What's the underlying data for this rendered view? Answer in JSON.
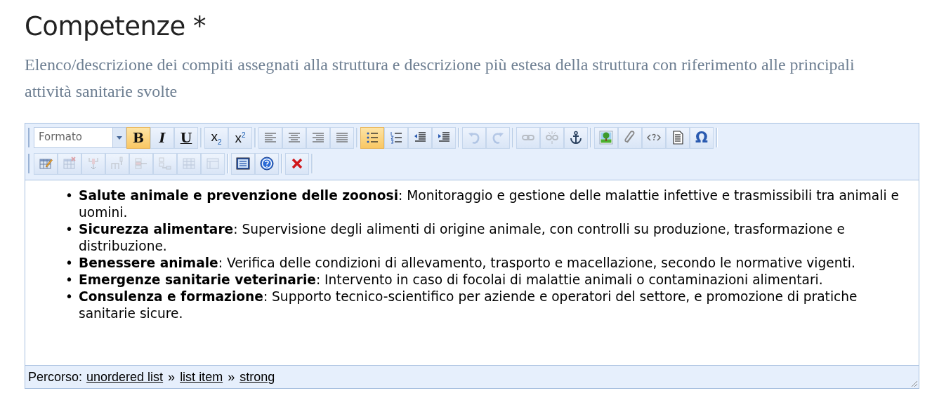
{
  "heading": {
    "title": "Competenze *",
    "description": "Elenco/descrizione dei compiti assegnati alla struttura e descrizione più estesa della struttura con riferimento alle principali attività sanitarie svolte"
  },
  "editor": {
    "toolbar_rows": [
      [
        {
          "kind": "format",
          "placeholder": "Formato"
        },
        {
          "kind": "bold",
          "glyph": "B",
          "active": true,
          "disabled": false
        },
        {
          "kind": "italic",
          "glyph": "I",
          "active": false,
          "disabled": false
        },
        {
          "kind": "underline",
          "glyph": "U",
          "active": false,
          "disabled": false
        },
        {
          "kind": "sep"
        },
        {
          "kind": "subscript",
          "glyph": "x$_{2}$",
          "active": false,
          "disabled": false
        },
        {
          "kind": "superscript",
          "glyph": "x$^{2}$",
          "active": false,
          "disabled": false
        },
        {
          "kind": "sep"
        },
        {
          "kind": "align-left",
          "active": false,
          "disabled": false
        },
        {
          "kind": "align-center",
          "active": false,
          "disabled": false
        },
        {
          "kind": "align-right",
          "active": false,
          "disabled": false
        },
        {
          "kind": "justify",
          "active": false,
          "disabled": false
        },
        {
          "kind": "sep"
        },
        {
          "kind": "bullet-list",
          "active": true,
          "disabled": false
        },
        {
          "kind": "numbered-list",
          "active": false,
          "disabled": false
        },
        {
          "kind": "outdent",
          "active": false,
          "disabled": false
        },
        {
          "kind": "indent",
          "active": false,
          "disabled": false
        },
        {
          "kind": "sep"
        },
        {
          "kind": "undo",
          "active": false,
          "disabled": true
        },
        {
          "kind": "redo",
          "active": false,
          "disabled": true
        },
        {
          "kind": "sep"
        },
        {
          "kind": "link",
          "active": false,
          "disabled": true
        },
        {
          "kind": "unlink",
          "active": false,
          "disabled": true
        },
        {
          "kind": "anchor",
          "active": false,
          "disabled": false
        },
        {
          "kind": "sep"
        },
        {
          "kind": "image",
          "active": false,
          "disabled": false
        },
        {
          "kind": "attachment",
          "active": false,
          "disabled": false
        },
        {
          "kind": "code",
          "active": false,
          "disabled": false
        },
        {
          "kind": "document",
          "active": false,
          "disabled": false
        },
        {
          "kind": "special-char",
          "glyph": "Ω",
          "active": false,
          "disabled": false
        }
      ],
      [
        {
          "kind": "table",
          "active": false,
          "disabled": false
        },
        {
          "kind": "table-delete",
          "active": false,
          "disabled": true
        },
        {
          "kind": "col-insert",
          "active": false,
          "disabled": true
        },
        {
          "kind": "col-after",
          "active": false,
          "disabled": true
        },
        {
          "kind": "row-insert",
          "active": false,
          "disabled": true
        },
        {
          "kind": "row-after",
          "active": false,
          "disabled": true
        },
        {
          "kind": "cells",
          "active": false,
          "disabled": true
        },
        {
          "kind": "table-props",
          "active": false,
          "disabled": true
        },
        {
          "kind": "sep"
        },
        {
          "kind": "fullscreen",
          "active": false,
          "disabled": false
        },
        {
          "kind": "help",
          "active": false,
          "disabled": false
        },
        {
          "kind": "sep"
        },
        {
          "kind": "close",
          "active": false,
          "disabled": false
        }
      ]
    ],
    "content": [
      {
        "marker": "•",
        "text": "**Salute animale e prevenzione delle zoonosi**: Monitoraggio e gestione delle malattie infettive e trasmissibili tra animali e uomini."
      },
      {
        "marker": "•",
        "text": "**Sicurezza alimentare**: Supervisione degli alimenti di origine animale, con controlli su produzione, trasformazione e distribuzione."
      },
      {
        "marker": "•",
        "text": "**Benessere animale**: Verifica delle condizioni di allevamento, trasporto e macellazione, secondo le normative vigenti."
      },
      {
        "marker": "•",
        "text": "**Emergenze sanitarie veterinarie**: Intervento in caso di focolai di malattie animali o contaminazioni alimentari."
      },
      {
        "marker": "•",
        "text": "**Consulenza e formazione**: Supporto tecnico-scientifico per aziende e operatori del settore, e promozione di pratiche sanitarie sicure."
      }
    ],
    "status_bar": {
      "label": "Percorso:",
      "path": [
        {
          "text": "unordered list"
        },
        {
          "text": "list item"
        },
        {
          "text": "strong"
        }
      ],
      "separator": "»"
    }
  }
}
